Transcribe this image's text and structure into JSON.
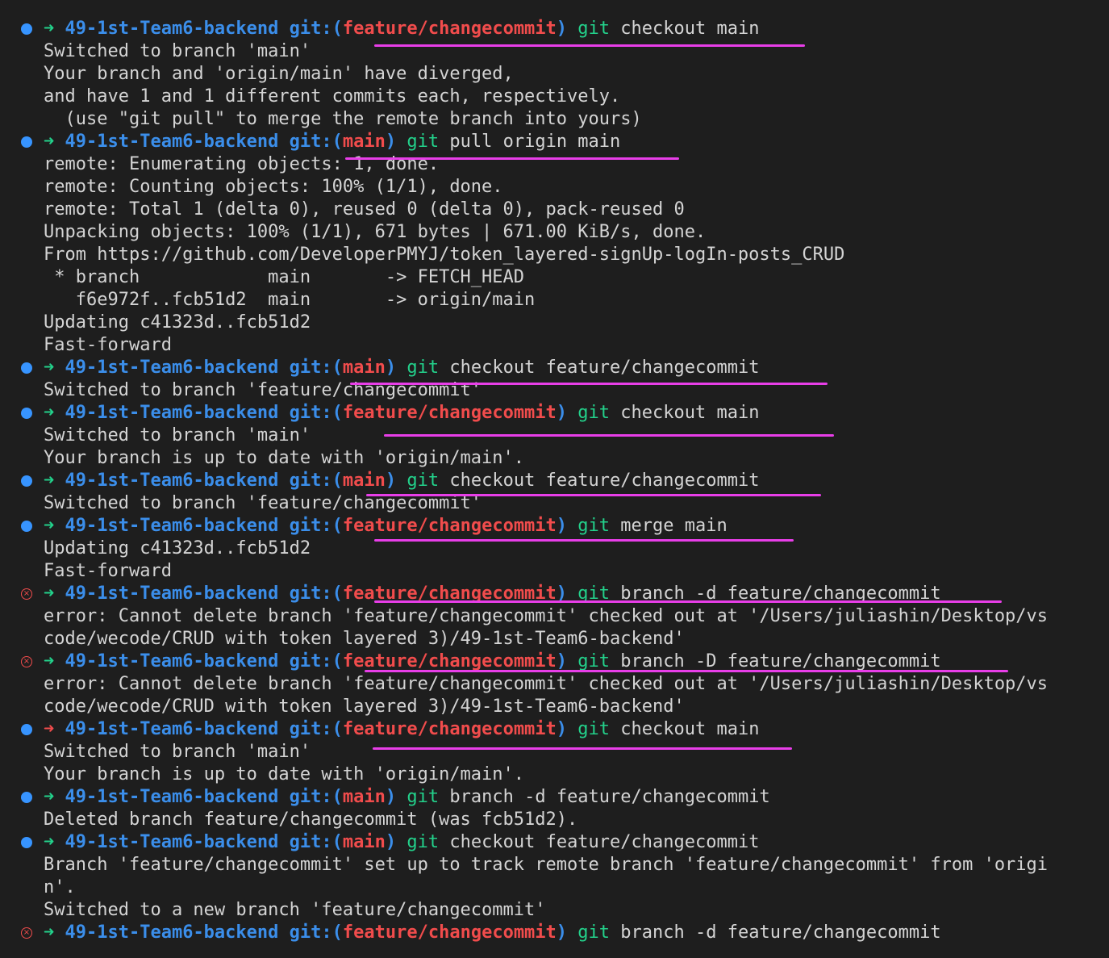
{
  "prompt": {
    "dir": "49-1st-Team6-backend",
    "git_open": "git:(",
    "git_close": ")",
    "arrow": "➜"
  },
  "lines": [
    {
      "type": "prompt",
      "status": "ok",
      "branch": "feature/changecommit",
      "cmd": "git",
      "args": " checkout main"
    },
    {
      "type": "out",
      "text": "Switched to branch 'main'"
    },
    {
      "type": "out",
      "text": "Your branch and 'origin/main' have diverged,"
    },
    {
      "type": "out",
      "text": "and have 1 and 1 different commits each, respectively."
    },
    {
      "type": "out",
      "text": "  (use \"git pull\" to merge the remote branch into yours)"
    },
    {
      "type": "prompt",
      "status": "ok",
      "branch": "main",
      "cmd": "git",
      "args": " pull origin main"
    },
    {
      "type": "out",
      "text": "remote: Enumerating objects: 1, done."
    },
    {
      "type": "out",
      "text": "remote: Counting objects: 100% (1/1), done."
    },
    {
      "type": "out",
      "text": "remote: Total 1 (delta 0), reused 0 (delta 0), pack-reused 0"
    },
    {
      "type": "out",
      "text": "Unpacking objects: 100% (1/1), 671 bytes | 671.00 KiB/s, done."
    },
    {
      "type": "out",
      "text": "From https://github.com/DeveloperPMYJ/token_layered-signUp-logIn-posts_CRUD"
    },
    {
      "type": "out",
      "text": " * branch            main       -> FETCH_HEAD"
    },
    {
      "type": "out",
      "text": "   f6e972f..fcb51d2  main       -> origin/main"
    },
    {
      "type": "out",
      "text": "Updating c41323d..fcb51d2"
    },
    {
      "type": "out",
      "text": "Fast-forward"
    },
    {
      "type": "prompt",
      "status": "ok",
      "branch": "main",
      "cmd": "git",
      "args": " checkout feature/changecommit"
    },
    {
      "type": "out",
      "text": "Switched to branch 'feature/changecommit'"
    },
    {
      "type": "prompt",
      "status": "ok",
      "branch": "feature/changecommit",
      "cmd": "git",
      "args": " checkout main"
    },
    {
      "type": "out",
      "text": "Switched to branch 'main'"
    },
    {
      "type": "out",
      "text": "Your branch is up to date with 'origin/main'."
    },
    {
      "type": "prompt",
      "status": "ok",
      "branch": "main",
      "cmd": "git",
      "args": " checkout feature/changecommit"
    },
    {
      "type": "out",
      "text": "Switched to branch 'feature/changecommit'"
    },
    {
      "type": "prompt",
      "status": "ok",
      "branch": "feature/changecommit",
      "cmd": "git",
      "args": " merge main"
    },
    {
      "type": "out",
      "text": "Updating c41323d..fcb51d2"
    },
    {
      "type": "out",
      "text": "Fast-forward"
    },
    {
      "type": "prompt",
      "status": "err",
      "branch": "feature/changecommit",
      "cmd": "git",
      "args": " branch -d feature/changecommit"
    },
    {
      "type": "out",
      "text": "error: Cannot delete branch 'feature/changecommit' checked out at '/Users/juliashin/Desktop/vs"
    },
    {
      "type": "out",
      "text": "code/wecode/CRUD with token layered 3)/49-1st-Team6-backend'"
    },
    {
      "type": "prompt",
      "status": "err",
      "branch": "feature/changecommit",
      "cmd": "git",
      "args": " branch -D feature/changecommit"
    },
    {
      "type": "out",
      "text": "error: Cannot delete branch 'feature/changecommit' checked out at '/Users/juliashin/Desktop/vs"
    },
    {
      "type": "out",
      "text": "code/wecode/CRUD with token layered 3)/49-1st-Team6-backend'"
    },
    {
      "type": "prompt",
      "status": "ok",
      "arrow_red": true,
      "branch": "feature/changecommit",
      "cmd": "git",
      "args": " checkout main"
    },
    {
      "type": "out",
      "text": "Switched to branch 'main'"
    },
    {
      "type": "out",
      "text": "Your branch is up to date with 'origin/main'."
    },
    {
      "type": "prompt",
      "status": "ok",
      "branch": "main",
      "cmd": "git",
      "args": " branch -d feature/changecommit"
    },
    {
      "type": "out",
      "text": "Deleted branch feature/changecommit (was fcb51d2)."
    },
    {
      "type": "prompt",
      "status": "ok",
      "branch": "main",
      "cmd": "git",
      "args": " checkout feature/changecommit"
    },
    {
      "type": "out",
      "text": "Branch 'feature/changecommit' set up to track remote branch 'feature/changecommit' from 'origi"
    },
    {
      "type": "out",
      "text": "n'."
    },
    {
      "type": "out",
      "text": "Switched to a new branch 'feature/changecommit'"
    },
    {
      "type": "prompt",
      "status": "err",
      "branch": "feature/changecommit",
      "cmd": "git",
      "args": " branch -d feature/changecommit"
    }
  ],
  "colors": {
    "background": "#1e1e1e",
    "text": "#d4d4d4",
    "dir_blue": "#3b8eea",
    "branch_red": "#f14c4c",
    "arrow_green": "#23d18b",
    "status_dot_blue": "#3794ff",
    "annotation_magenta": "#e83ee8"
  }
}
